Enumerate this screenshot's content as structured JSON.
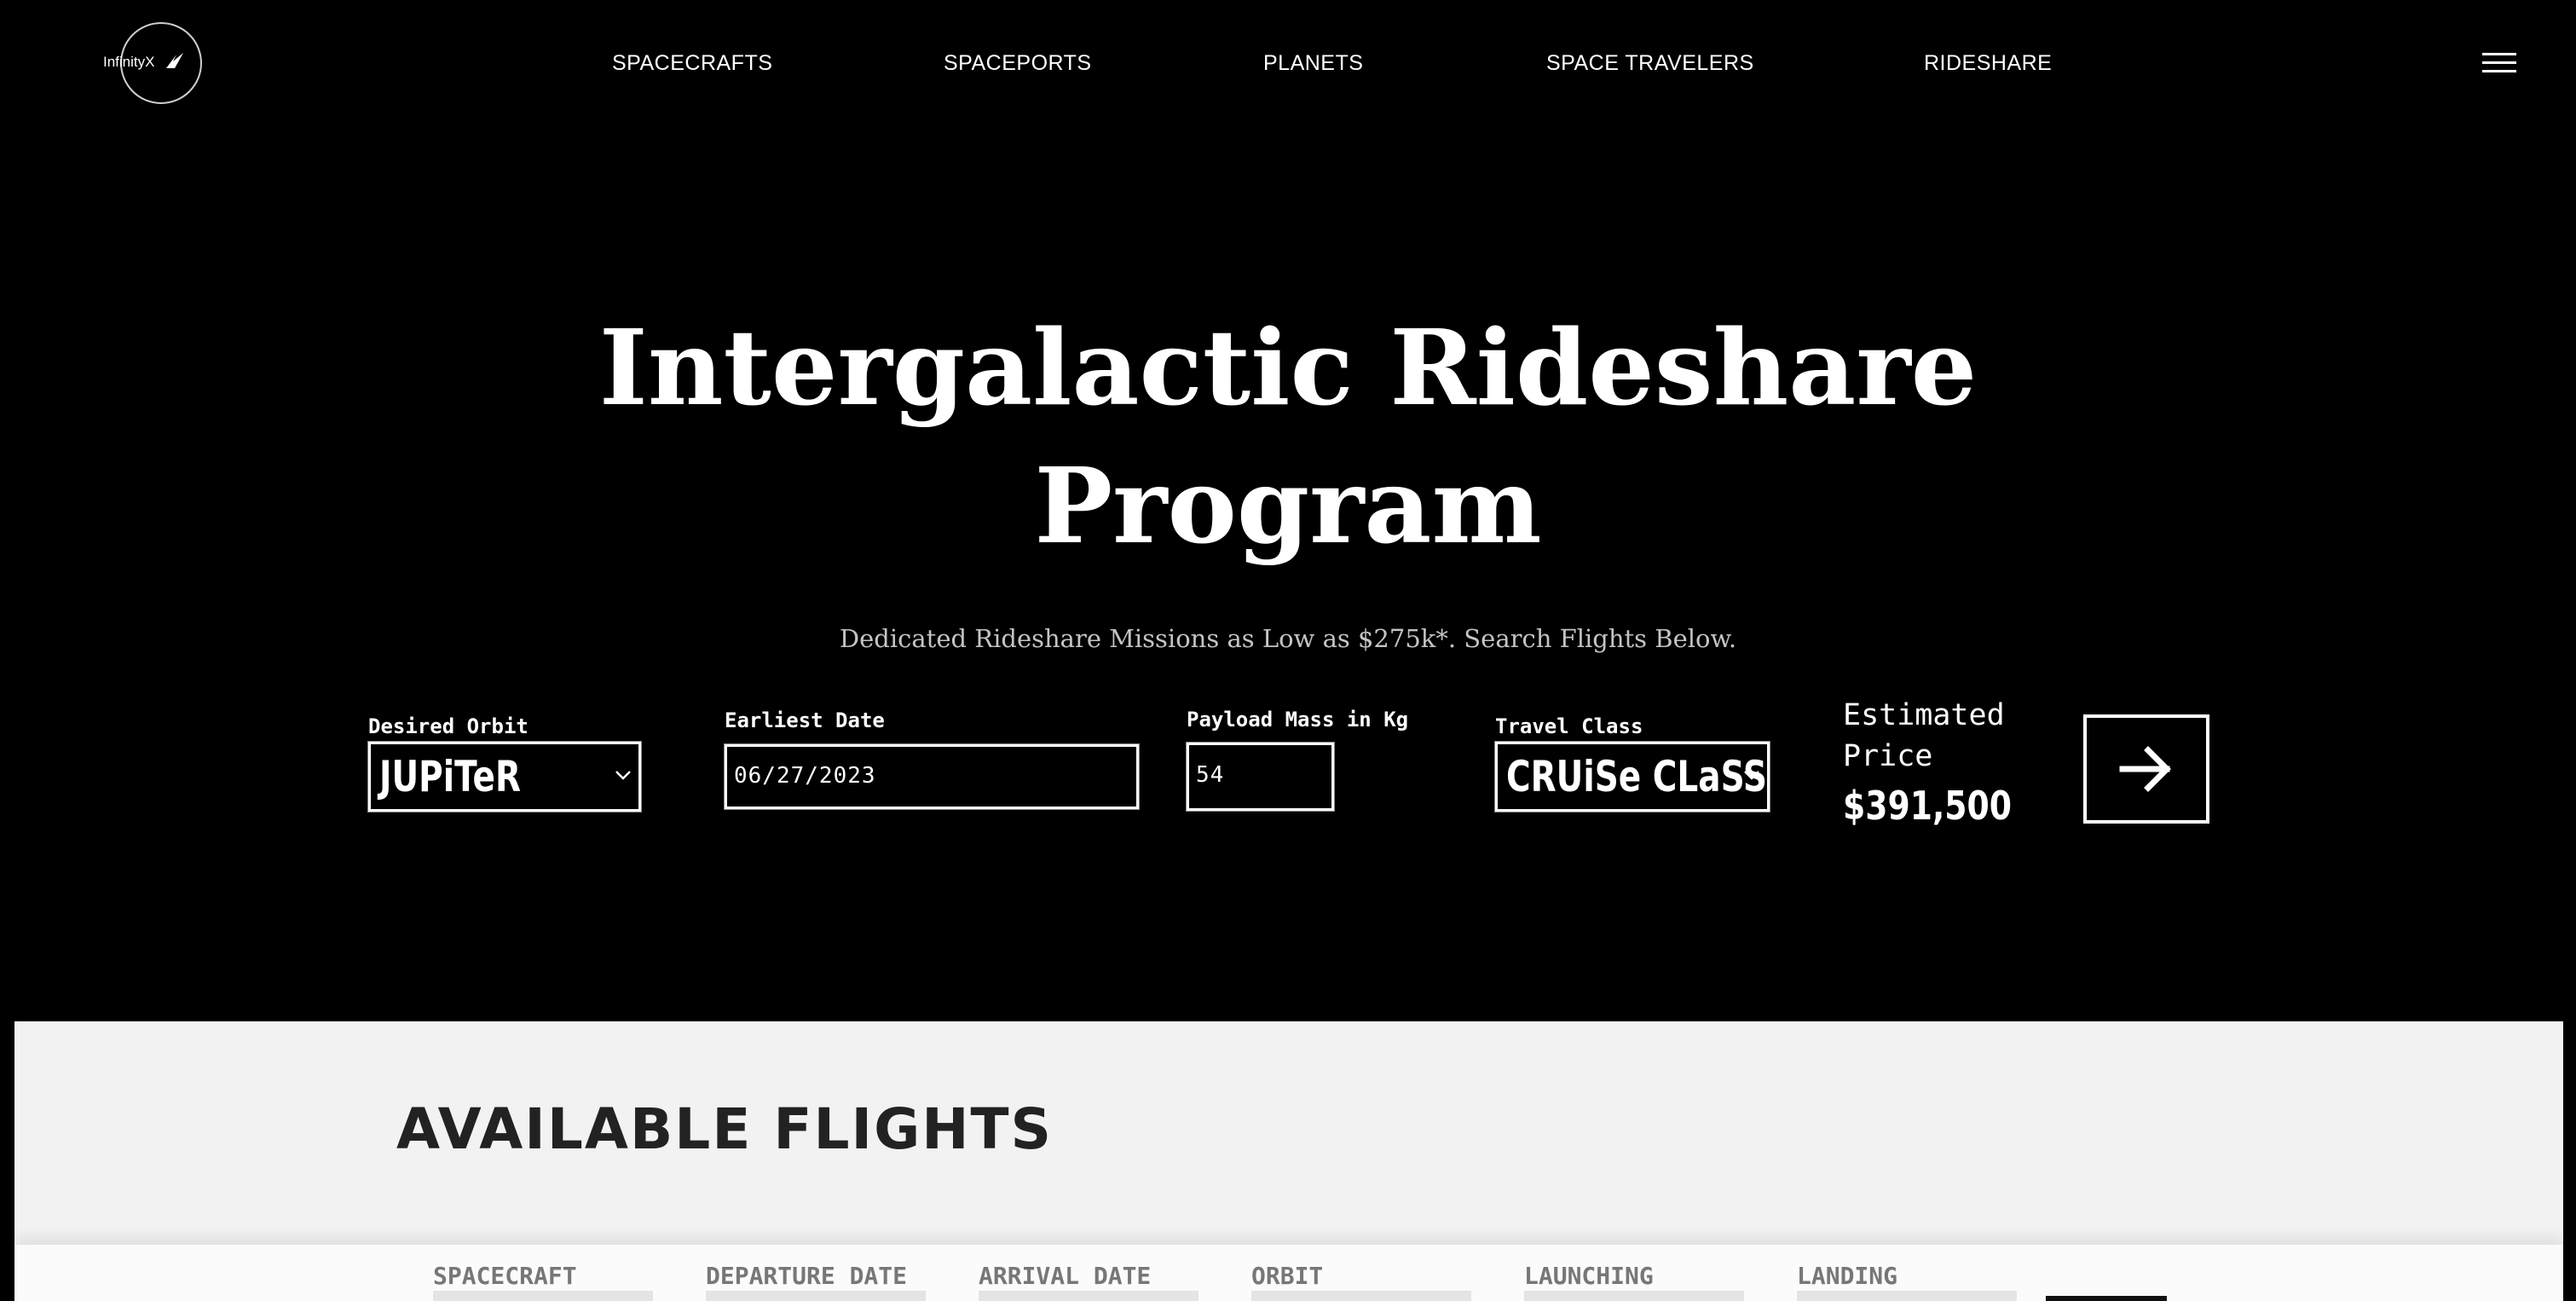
{
  "brand": {
    "logo_text": "InfinityX"
  },
  "nav": {
    "items": [
      {
        "label": "SPACECRAFTS"
      },
      {
        "label": "SPACEPORTS"
      },
      {
        "label": "PLANETS"
      },
      {
        "label": "SPACE TRAVELERS"
      },
      {
        "label": "RIDESHARE"
      }
    ],
    "menu_icon": "hamburger-icon"
  },
  "hero": {
    "title_line1": "Intergalactic Rideshare",
    "title_line2": "Program",
    "subtitle": "Dedicated Rideshare Missions as Low as $275k*. Search Flights Below."
  },
  "search": {
    "orbit": {
      "label": "Desired Orbit",
      "value": "JUPiTeR"
    },
    "date": {
      "label": "Earliest Date",
      "value": "06/27/2023"
    },
    "mass": {
      "label": "Payload Mass in Kg",
      "value": "54"
    },
    "travel_class": {
      "label": "Travel Class",
      "value": "CRUiSe CLaSS"
    },
    "price": {
      "label": "Estimated Price",
      "value": "$391,500"
    },
    "submit_icon": "arrow-right-icon"
  },
  "flights": {
    "title": "AVAILABLE FLIGHTS",
    "columns": [
      "SPACECRAFT",
      "DEPARTURE DATE",
      "ARRIVAL DATE",
      "ORBIT",
      "LAUNCHING",
      "LANDING"
    ]
  },
  "colors": {
    "background": "#000000",
    "text": "#ffffff",
    "section_bg": "#f2f2f2",
    "column_header": "#777777"
  }
}
